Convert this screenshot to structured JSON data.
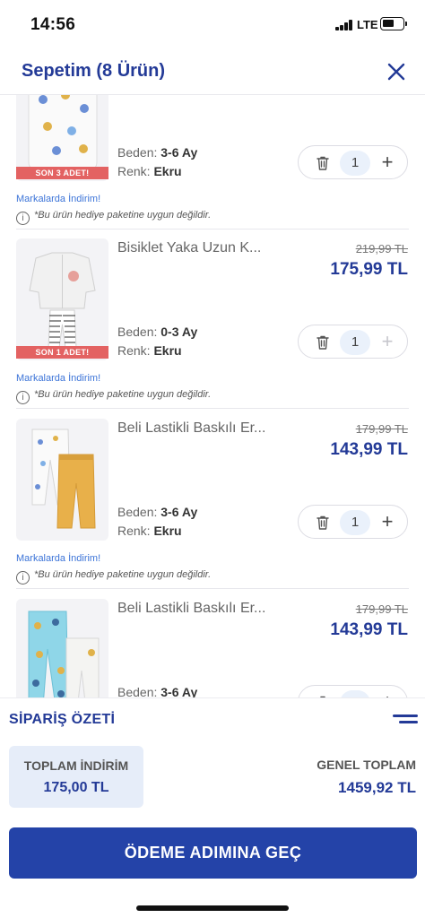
{
  "status_bar": {
    "time": "14:56",
    "network": "LTE"
  },
  "header": {
    "title": "Sepetim (8 Ürün)"
  },
  "items": [
    {
      "name": "",
      "old_price": "",
      "new_price": "",
      "size_label": "Beden:",
      "size": "3-6 Ay",
      "color_label": "Renk:",
      "color": "Ekru",
      "stock_badge": "SON 3 ADET!",
      "quantity": "1",
      "promo": "Markalarda İndirim!",
      "gift_note": "*Bu ürün hediye paketine uygun değildir."
    },
    {
      "name": "Bisiklet Yaka Uzun K...",
      "old_price": "219,99 TL",
      "new_price": "175,99 TL",
      "size_label": "Beden:",
      "size": "0-3 Ay",
      "color_label": "Renk:",
      "color": "Ekru",
      "stock_badge": "SON 1 ADET!",
      "quantity": "1",
      "promo": "Markalarda İndirim!",
      "gift_note": "*Bu ürün hediye paketine uygun değildir."
    },
    {
      "name": "Beli Lastikli Baskılı Er...",
      "old_price": "179,99 TL",
      "new_price": "143,99 TL",
      "size_label": "Beden:",
      "size": "3-6 Ay",
      "color_label": "Renk:",
      "color": "Ekru",
      "stock_badge": "",
      "quantity": "1",
      "promo": "Markalarda İndirim!",
      "gift_note": "*Bu ürün hediye paketine uygun değildir."
    },
    {
      "name": "Beli Lastikli Baskılı Er...",
      "old_price": "179,99 TL",
      "new_price": "143,99 TL",
      "size_label": "Beden:",
      "size": "3-6 Ay",
      "color_label": "",
      "color": "",
      "stock_badge": "",
      "quantity": "",
      "promo": "",
      "gift_note": ""
    }
  ],
  "summary": {
    "title": "SİPARİŞ ÖZETİ",
    "discount_label": "TOPLAM İNDİRİM",
    "discount_value": "175,00 TL",
    "total_label": "GENEL TOPLAM",
    "total_value": "1459,92 TL"
  },
  "footer": {
    "checkout_label": "ÖDEME ADIMINA GEÇ"
  },
  "colors": {
    "brand": "#233a97",
    "button": "#2443a8",
    "badge": "#e36262",
    "promo": "#3c74d8"
  }
}
